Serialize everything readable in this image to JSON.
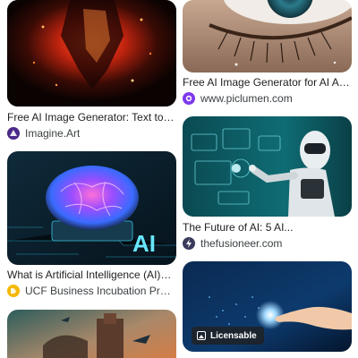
{
  "results": [
    {
      "title": "Free AI Image Generator: Text to Image Online",
      "source": "Imagine.Art",
      "favicon_color": "#4b2a8a"
    },
    {
      "title": "Free AI Image Generator for AI Art Creation",
      "source": "www.piclumen.com",
      "favicon_color": "#7c3aed"
    },
    {
      "title": "The Future of AI: 5 AI...",
      "source": "thefusioneer.com",
      "favicon_color": "#3b3b5c"
    },
    {
      "title": "What is Artificial Intelligence (AI)? ...",
      "source": "UCF Business Incubation Program",
      "favicon_color": "#f5b800",
      "image_overlay_text": "AI"
    },
    {
      "badge": "Licensable"
    }
  ],
  "colors": {
    "title_text": "#202124",
    "source_text": "#3c4043"
  }
}
